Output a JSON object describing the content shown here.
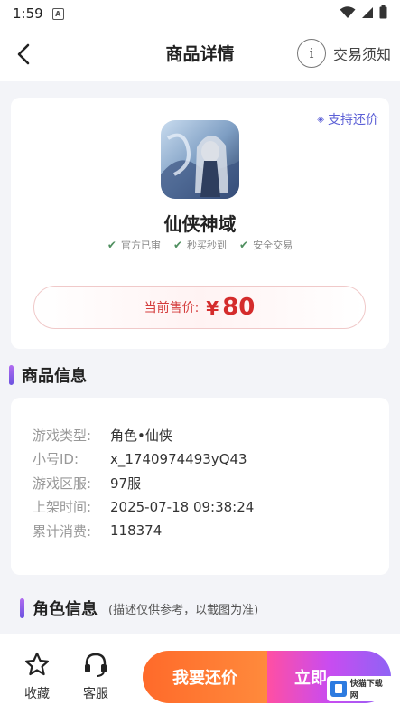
{
  "status_bar": {
    "time": "1:59",
    "notification": "A"
  },
  "header": {
    "title": "商品详情",
    "notice_label": "交易须知",
    "notice_icon": "i"
  },
  "product": {
    "bargain_tag": "支持还价",
    "game_name": "仙侠神域",
    "badges": [
      "官方已审",
      "秒买秒到",
      "安全交易"
    ],
    "price_label": "当前售价:",
    "price_currency": "¥",
    "price_value": "80"
  },
  "info_section": {
    "title": "商品信息",
    "rows": [
      {
        "label": "游戏类型:",
        "value": "角色•仙侠"
      },
      {
        "label": "小号ID:",
        "value": "x_1740974493yQ43"
      },
      {
        "label": "游戏区服:",
        "value": "97服"
      },
      {
        "label": "上架时间:",
        "value": "2025-07-18 09:38:24"
      },
      {
        "label": "累计消费:",
        "value": "118374"
      }
    ]
  },
  "role_section": {
    "title": "角色信息",
    "note": "(描述仅供参考，以截图为准)"
  },
  "bottom_bar": {
    "favorite_label": "收藏",
    "service_label": "客服",
    "bargain_button": "我要还价",
    "buy_button": "立即"
  },
  "watermark": {
    "text": "快猫下载网"
  },
  "colors": {
    "accent": "#6b52e0",
    "price": "#d42c2c",
    "bargain": "#ff6a2a",
    "buy": "#c94cf0"
  }
}
